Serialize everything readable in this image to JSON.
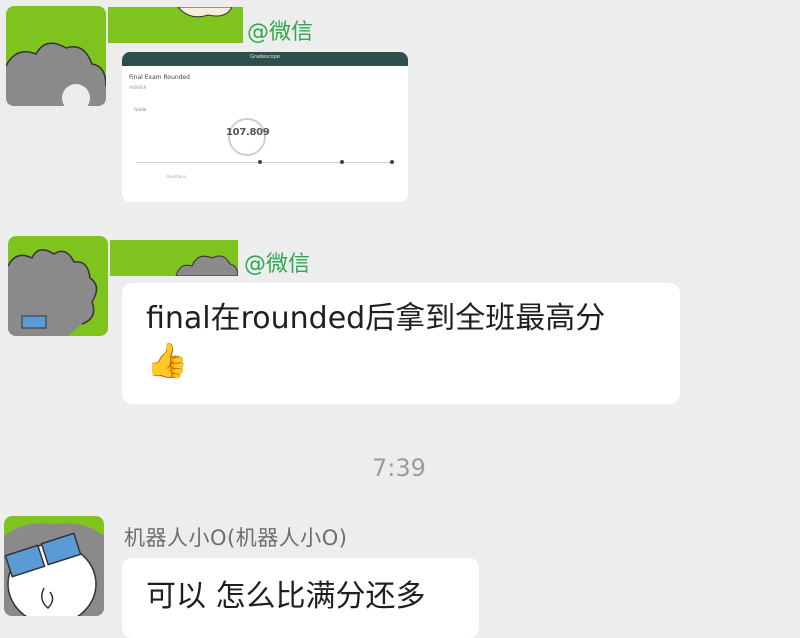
{
  "messages": [
    {
      "type": "image",
      "sender_tag": "@微信"
    },
    {
      "type": "text",
      "sender_tag": "@微信",
      "text": "final在rounded后拿到全班最高分",
      "emoji": "👍"
    }
  ],
  "timestamp": "7:39",
  "reply": {
    "sender": "机器人小O(机器人小O)",
    "text": "可以 怎么比满分还多"
  },
  "shared_image": {
    "topbar": "Gradescope",
    "title": "Final Exam Rounded",
    "subtitle": "ANSWER",
    "label_left": "Grade",
    "label_right": "",
    "score": "107.809",
    "score_caption": "",
    "footer": [
      "Questions",
      "",
      ""
    ]
  },
  "colors": {
    "background": "#ededed",
    "bubble": "#ffffff",
    "wechat_green": "#2fa84f",
    "avatar_green": "#7fc41e"
  },
  "icons": [
    "cartoon-avatar-icon",
    "thumbs-up-icon",
    "sunglasses-avatar-icon"
  ]
}
